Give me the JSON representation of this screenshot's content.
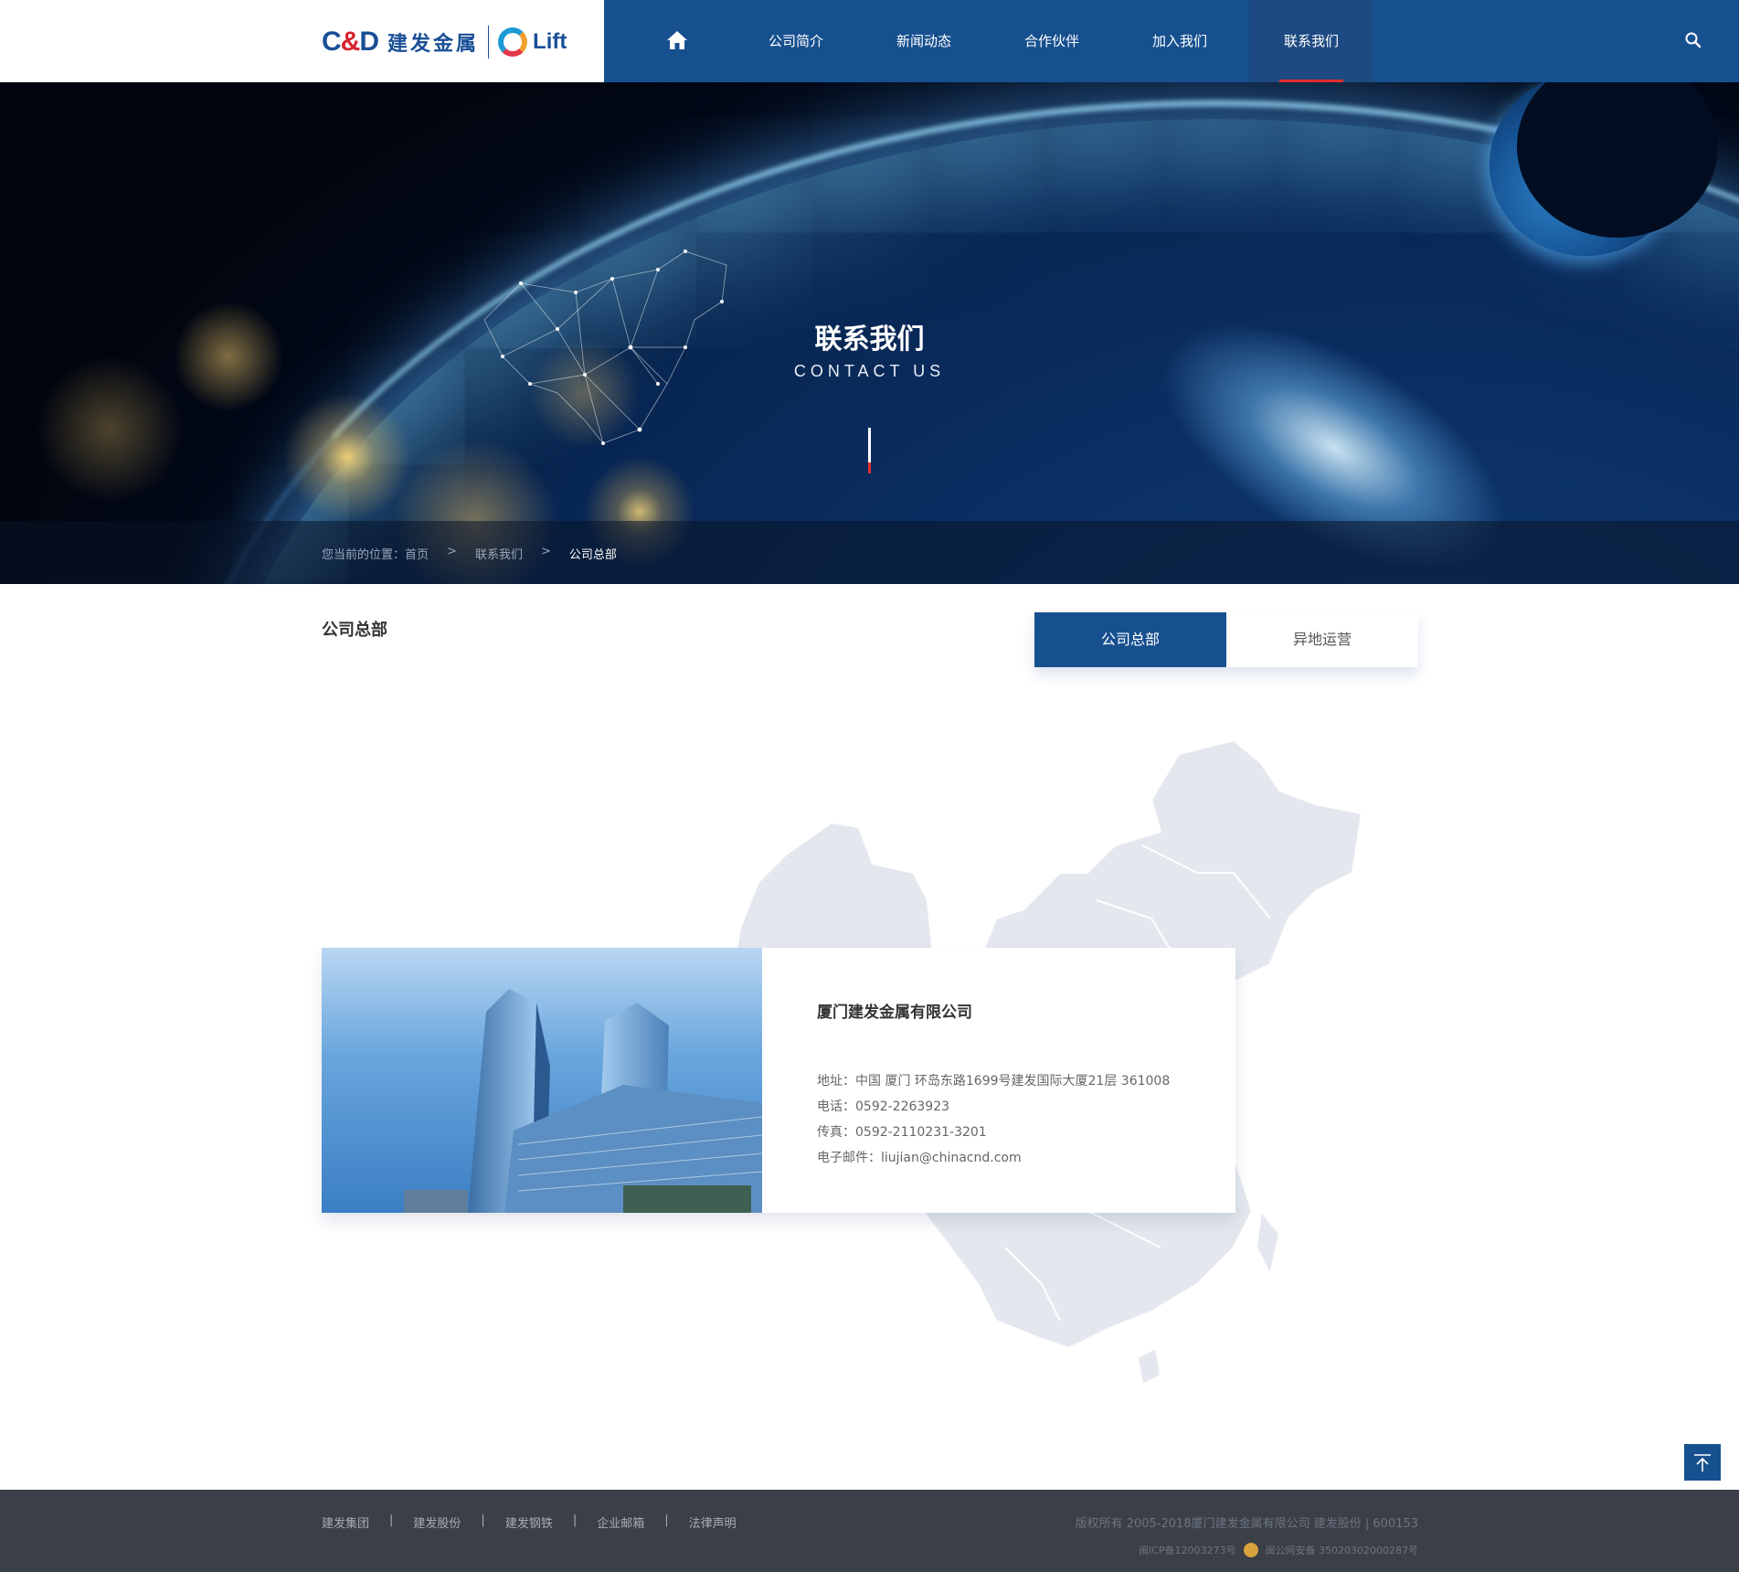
{
  "header": {
    "logo": {
      "brand": "C&D",
      "brand_cn": "建发金属",
      "sub_brand": "Lift"
    },
    "nav": {
      "home_icon": "home-icon",
      "items": [
        {
          "label": "公司简介"
        },
        {
          "label": "新闻动态"
        },
        {
          "label": "合作伙伴"
        },
        {
          "label": "加入我们"
        },
        {
          "label": "联系我们",
          "active": true
        }
      ],
      "search_icon": "search-icon"
    }
  },
  "banner": {
    "title": "联系我们",
    "subtitle": "CONTACT US",
    "breadcrumb": {
      "prefix": "您当前的位置：",
      "items": [
        "首页",
        "联系我们",
        "公司总部"
      ],
      "separator": ">"
    }
  },
  "main": {
    "section_title": "公司总部",
    "tabs": [
      {
        "label": "公司总部",
        "active": true
      },
      {
        "label": "异地运营",
        "active": false
      }
    ],
    "card": {
      "company_name": "厦门建发金属有限公司",
      "address": "地址：中国 厦门 环岛东路1699号建发国际大厦21层 361008",
      "phone": "电话：0592-2263923",
      "fax": "传真：0592-2110231-3201",
      "email": "电子邮件：liujian@chinacnd.com"
    }
  },
  "footer": {
    "links": [
      "建发集团",
      "建发股份",
      "建发钢铁",
      "企业邮箱",
      "法律声明"
    ],
    "link_separator": "|",
    "copyright": "版权所有 2005-2018厦门建发金属有限公司 建发股份 | 600153",
    "icp": "闽ICP备12003273号",
    "police_record": "闽公网安备 35020302000287号"
  },
  "colors": {
    "nav_blue": "#17508f",
    "active_underline": "#e12d2d",
    "footer_bg": "#3a3f48"
  }
}
